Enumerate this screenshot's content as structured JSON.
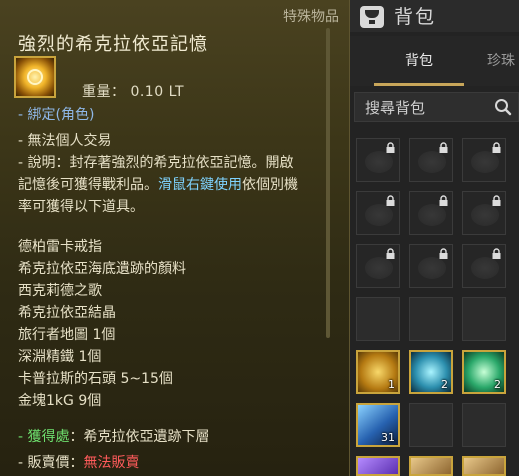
{
  "tooltip": {
    "category": "特殊物品",
    "item_name": "強烈的希克拉依亞記憶",
    "weight": "重量： 0.10 LT",
    "bind": "- 綁定(角色)",
    "trade": "- 無法個人交易",
    "desc_line1": "- 說明：封存著強烈的希克拉依亞記憶。開啟",
    "desc_line2": "記憶後可獲得戰利品。",
    "desc_line2_hl": "滑鼠右鍵使用",
    "desc_line2_tail": "依個別機",
    "desc_line3": "率可獲得以下道具。",
    "rewards": [
      "德柏雷卡戒指",
      "希克拉依亞海底遺跡的顏料",
      "西克莉德之歌",
      "希克拉依亞結晶",
      "旅行者地圖 1個",
      "深淵精鐵 1個",
      "卡普拉斯的石頭 5~15個",
      "金塊1kG 9個"
    ],
    "obtain_label": "獲得處",
    "obtain_value": "：希克拉依亞遺跡下層",
    "sell_label": "- 販賣價：",
    "sell_value": "無法販賣",
    "dash": "- "
  },
  "inventory": {
    "title": "背包",
    "tabs": [
      {
        "label": "背包"
      },
      {
        "label": "珍珠"
      }
    ],
    "search_placeholder": "搜尋背包",
    "counts": {
      "gold": "1",
      "cyan": "2",
      "green": "2",
      "blue": "31"
    }
  },
  "colors": {
    "accent": "#c9a43c",
    "highlight_blue": "#7fd4ff",
    "obtain_green": "#6ee06e",
    "cannot_sell_red": "#ff5b5b"
  }
}
